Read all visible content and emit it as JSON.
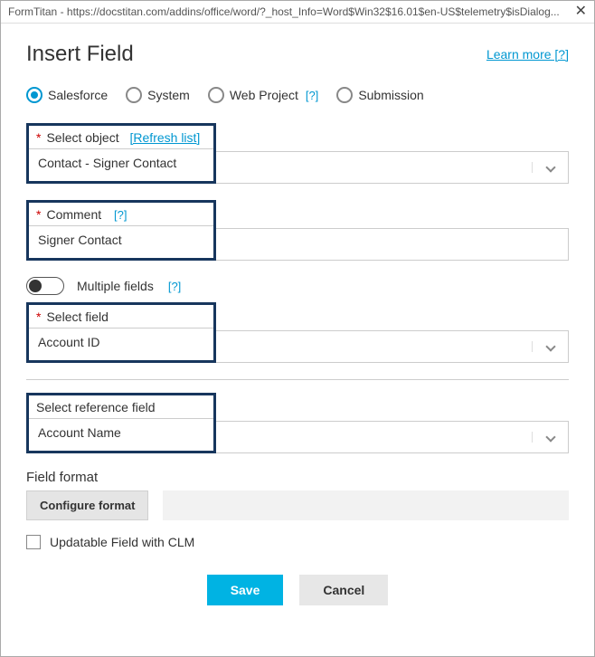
{
  "titlebar": {
    "text": "FormTitan - https://docstitan.com/addins/office/word/?_host_Info=Word$Win32$16.01$en-US$telemetry$isDialog..."
  },
  "header": {
    "title": "Insert Field",
    "learn_more": "Learn more [?]"
  },
  "tabs": {
    "salesforce": "Salesforce",
    "system": "System",
    "web_project": "Web Project",
    "web_project_q": "[?]",
    "submission": "Submission"
  },
  "select_object": {
    "label": "Select object",
    "refresh": "[Refresh list]",
    "value": "Contact - Signer Contact"
  },
  "comment": {
    "label": "Comment",
    "q": "[?]",
    "value": "Signer Contact"
  },
  "multiple_fields": {
    "label": "Multiple fields",
    "q": "[?]"
  },
  "select_field": {
    "label": "Select field",
    "value": "Account ID"
  },
  "select_ref": {
    "label": "Select reference field",
    "value": "Account Name"
  },
  "field_format": {
    "label": "Field format",
    "button": "Configure format",
    "value": ""
  },
  "updatable": {
    "label": "Updatable Field with CLM"
  },
  "buttons": {
    "save": "Save",
    "cancel": "Cancel"
  }
}
